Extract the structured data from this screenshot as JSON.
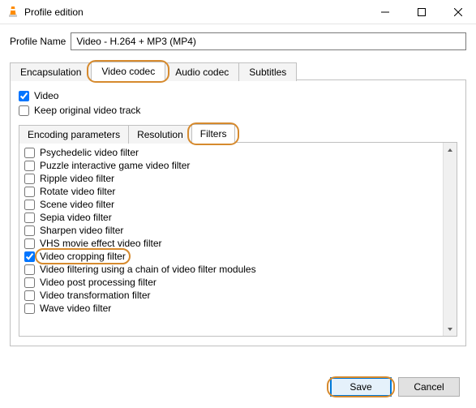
{
  "title": "Profile edition",
  "profile_name_label": "Profile Name",
  "profile_name_value": "Video - H.264 + MP3 (MP4)",
  "main_tabs": {
    "encapsulation": "Encapsulation",
    "video_codec": "Video codec",
    "audio_codec": "Audio codec",
    "subtitles": "Subtitles"
  },
  "checkboxes": {
    "video_label": "Video",
    "video_checked": true,
    "keep_label": "Keep original video track",
    "keep_checked": false
  },
  "sub_tabs": {
    "encoding": "Encoding parameters",
    "resolution": "Resolution",
    "filters": "Filters"
  },
  "filters": [
    {
      "label": "Psychedelic video filter",
      "checked": false
    },
    {
      "label": "Puzzle interactive game video filter",
      "checked": false
    },
    {
      "label": "Ripple video filter",
      "checked": false
    },
    {
      "label": "Rotate video filter",
      "checked": false
    },
    {
      "label": "Scene video filter",
      "checked": false
    },
    {
      "label": "Sepia video filter",
      "checked": false
    },
    {
      "label": "Sharpen video filter",
      "checked": false
    },
    {
      "label": "VHS movie effect video filter",
      "checked": false
    },
    {
      "label": "Video cropping filter",
      "checked": true,
      "highlight": true
    },
    {
      "label": "Video filtering using a chain of video filter modules",
      "checked": false
    },
    {
      "label": "Video post processing filter",
      "checked": false
    },
    {
      "label": "Video transformation filter",
      "checked": false
    },
    {
      "label": "Wave video filter",
      "checked": false
    }
  ],
  "buttons": {
    "save": "Save",
    "cancel": "Cancel"
  }
}
